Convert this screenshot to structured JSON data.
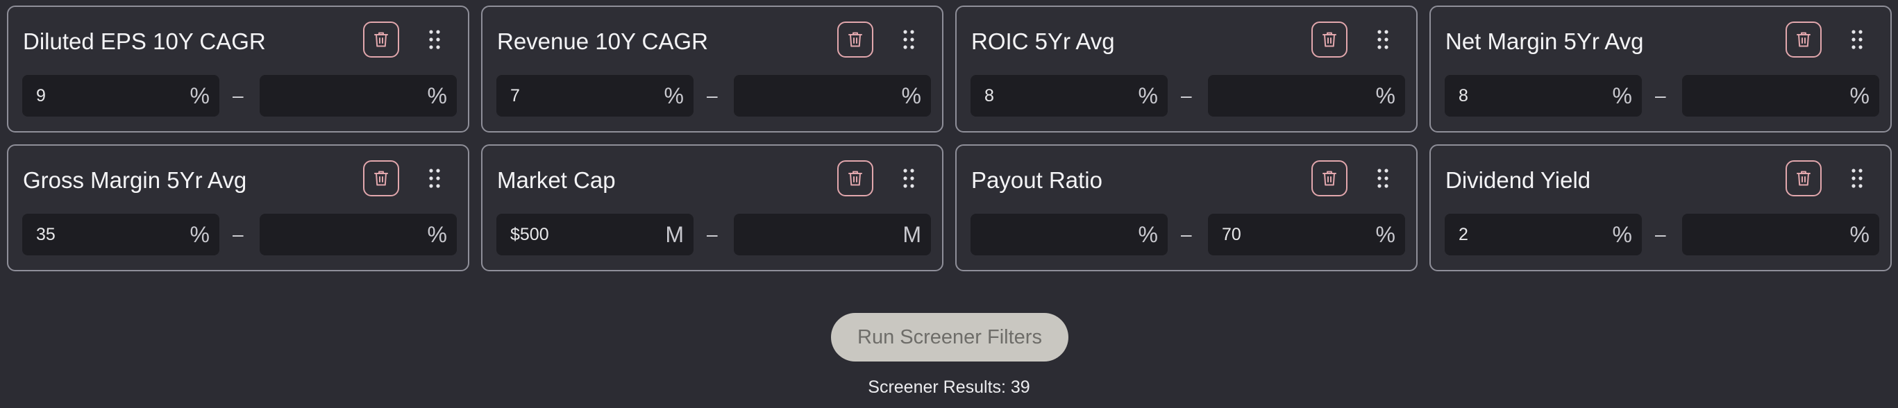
{
  "filters": [
    {
      "title": "Diluted EPS 10Y CAGR",
      "min": "9",
      "max": "",
      "unit": "%"
    },
    {
      "title": "Revenue 10Y CAGR",
      "min": "7",
      "max": "",
      "unit": "%"
    },
    {
      "title": "ROIC 5Yr Avg",
      "min": "8",
      "max": "",
      "unit": "%"
    },
    {
      "title": "Net Margin 5Yr Avg",
      "min": "8",
      "max": "",
      "unit": "%"
    },
    {
      "title": "Gross Margin 5Yr Avg",
      "min": "35",
      "max": "",
      "unit": "%"
    },
    {
      "title": "Market Cap",
      "min": "$500",
      "max": "",
      "unit": "M"
    },
    {
      "title": "Payout Ratio",
      "min": "",
      "max": "70",
      "unit": "%"
    },
    {
      "title": "Dividend Yield",
      "min": "2",
      "max": "",
      "unit": "%"
    }
  ],
  "separator": "–",
  "run_button_label": "Run Screener Filters",
  "results_text": "Screener Results: 39",
  "icons": {
    "delete": "trash-icon",
    "drag": "drag-handle-icon"
  },
  "colors": {
    "background": "#2c2c33",
    "card_border": "#8f8f99",
    "input_background": "#1d1d22",
    "trash_accent": "#e2a7ad",
    "run_button_background": "#c9c7c1"
  }
}
